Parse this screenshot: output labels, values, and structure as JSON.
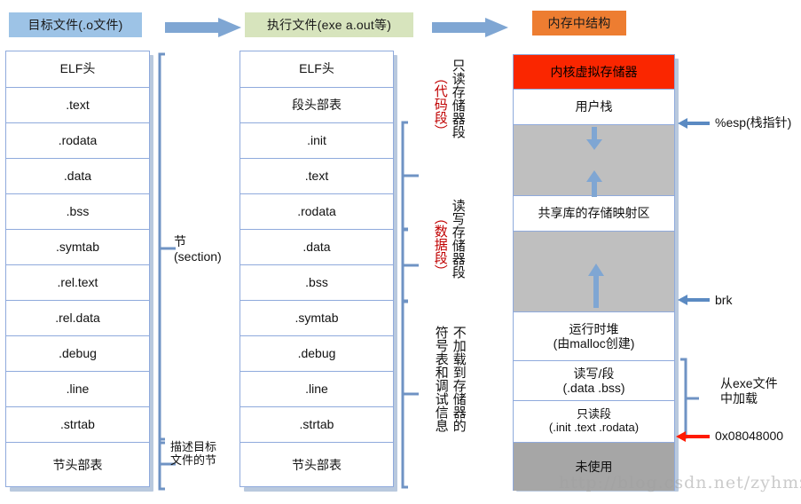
{
  "headers": {
    "object_file": "目标文件(.o文件)",
    "exec_file": "执行文件(exe a.out等)",
    "memory": "内存中结构"
  },
  "object_file_column": {
    "rows": [
      "ELF头",
      ".text",
      ".rodata",
      ".data",
      ".bss",
      ".symtab",
      ".rel.text",
      ".rel.data",
      ".debug",
      ".line",
      ".strtab",
      "节头部表"
    ]
  },
  "object_file_annotations": {
    "section": "节\n(section)",
    "section_header_desc": "描述目标\n文件的节"
  },
  "exec_file_column": {
    "rows": [
      "ELF头",
      "段头部表",
      ".init",
      ".text",
      ".rodata",
      ".data",
      ".bss",
      ".symtab",
      ".debug",
      ".line",
      ".strtab",
      "节头部表"
    ]
  },
  "exec_file_annotations": {
    "readonly_segment": "只读存储器段",
    "readonly_segment_sub": "（代码段）",
    "readwrite_segment": "读写存储器段",
    "readwrite_segment_sub": "（数据段）",
    "not_loaded": "不加载到存储器的",
    "not_loaded_sub": "符号表和调试信息"
  },
  "memory_column": {
    "rows": [
      {
        "label": "内核虚拟存储器",
        "style": "kernel"
      },
      {
        "label": "用户栈",
        "style": "white"
      },
      {
        "label": "",
        "style": "gray"
      },
      {
        "label": "共享库的存储映射区",
        "style": "white"
      },
      {
        "label": "",
        "style": "gray"
      },
      {
        "label": "运行时堆\n(由malloc创建)",
        "style": "white"
      },
      {
        "label": "读写/段\n(.data .bss)",
        "style": "white"
      },
      {
        "label": "只读段\n(.init .text .rodata)",
        "style": "white"
      },
      {
        "label": "未使用",
        "style": "darkgray"
      }
    ]
  },
  "memory_annotations": {
    "esp": "%esp(栈指针)",
    "brk": "brk",
    "loaded_from_exe": "从exe文件\n中加载",
    "base_address": "0x08048000"
  },
  "watermark": "http://blog.csdn.net/zyhmz",
  "colors": {
    "header_blue": "#9dc3e6",
    "header_green": "#d7e4bd",
    "header_orange": "#ed7d31",
    "kernel_red": "#fa2600",
    "gray_fill": "#bfbfbf",
    "dark_gray_fill": "#a6a6a6",
    "border_blue": "#8faadc",
    "arrow_blue": "#6f93c4",
    "arrow_red": "#ff0000",
    "annotation_red": "#c00000"
  }
}
